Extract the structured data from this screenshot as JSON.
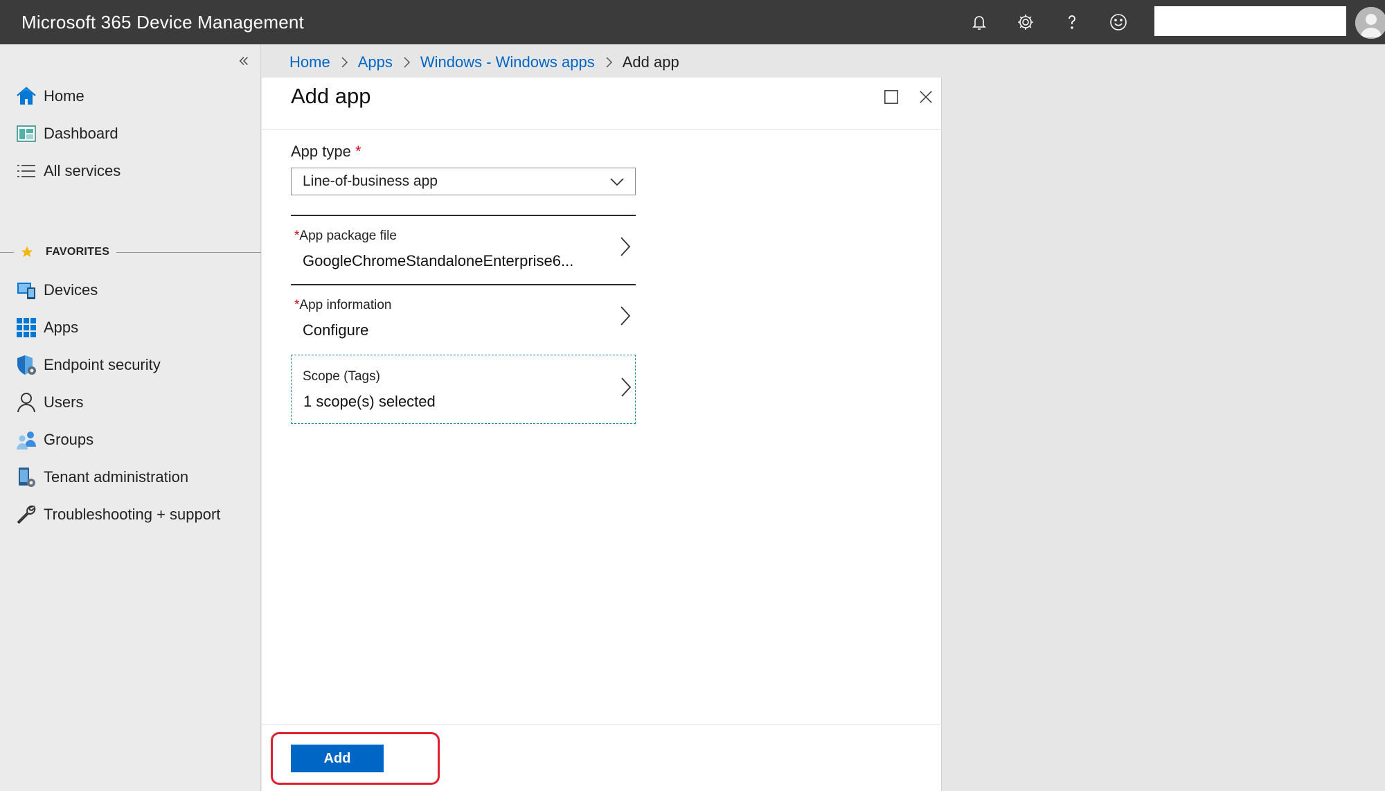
{
  "app": {
    "title": "Microsoft 365 Device Management"
  },
  "topbar": {
    "icons": [
      "bell-icon",
      "gear-icon",
      "help-icon",
      "smiley-icon"
    ],
    "account_text": ""
  },
  "sidebar": {
    "items": [
      {
        "label": "Home",
        "icon": "home-icon"
      },
      {
        "label": "Dashboard",
        "icon": "dashboard-icon"
      },
      {
        "label": "All services",
        "icon": "list-icon"
      }
    ],
    "favorites_label": "FAVORITES",
    "favorites": [
      {
        "label": "Devices",
        "icon": "devices-icon"
      },
      {
        "label": "Apps",
        "icon": "apps-grid-icon"
      },
      {
        "label": "Endpoint security",
        "icon": "shield-icon"
      },
      {
        "label": "Users",
        "icon": "user-icon"
      },
      {
        "label": "Groups",
        "icon": "groups-icon"
      },
      {
        "label": "Tenant administration",
        "icon": "tenant-icon"
      },
      {
        "label": "Troubleshooting + support",
        "icon": "wrench-icon"
      }
    ]
  },
  "breadcrumb": {
    "items": [
      "Home",
      "Apps",
      "Windows - Windows apps"
    ],
    "current": "Add app"
  },
  "blade": {
    "title": "Add app",
    "app_type": {
      "label": "App type",
      "required_mark": "*",
      "value": "Line-of-business app"
    },
    "rows": [
      {
        "required_mark": "*",
        "title": "App package file",
        "value": "GoogleChromeStandaloneEnterprise6..."
      },
      {
        "required_mark": "*",
        "title": "App information",
        "value": "Configure"
      },
      {
        "required_mark": "",
        "title": "Scope (Tags)",
        "value": "1 scope(s) selected"
      }
    ],
    "add_button": "Add"
  },
  "colors": {
    "topbar": "#3b3b3b",
    "link": "#0066c6",
    "primary_button": "#0066c6",
    "highlight": "#e0202e",
    "required": "#c50f1f"
  }
}
